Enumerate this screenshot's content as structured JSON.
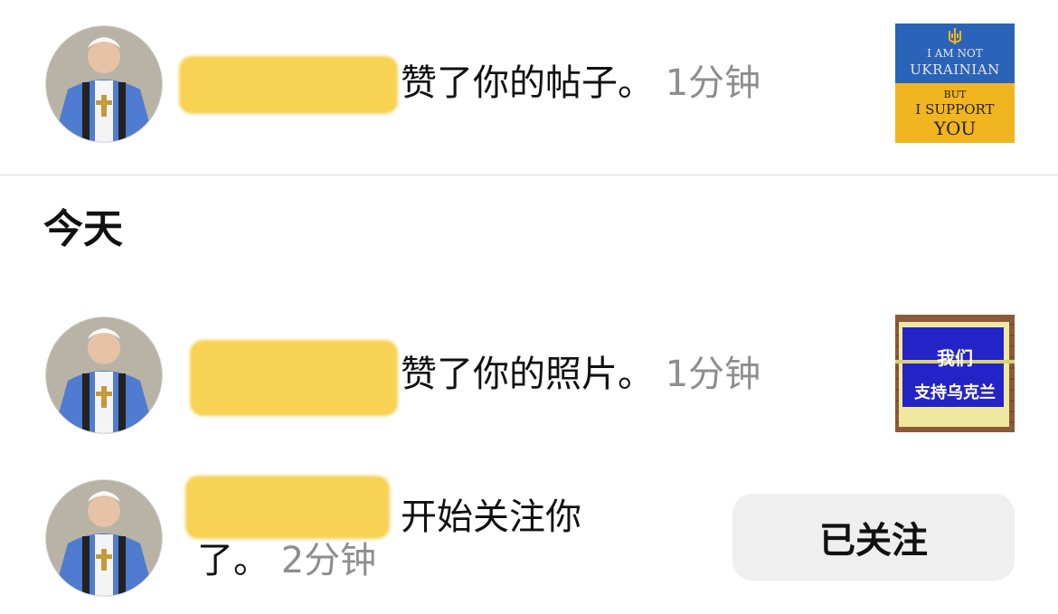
{
  "notifications": [
    {
      "action": "赞了你的帖子。",
      "time": "1分钟",
      "thumbnail": {
        "icon": "trident-icon",
        "line1": "I AM NOT",
        "line2": "UKRAINIAN",
        "line3": "BUT",
        "line4": "I SUPPORT",
        "line5": "YOU",
        "colors": {
          "top": "#2b63b8",
          "bottom": "#f1b51f"
        }
      }
    },
    {
      "action": "赞了你的照片。",
      "time": "1分钟",
      "thumbnail": {
        "line1": "我们",
        "line2": "支持乌克兰",
        "colors": {
          "sign": "#2323c8",
          "board": "#f1e8a0",
          "wall": "#8a5a3a"
        }
      }
    },
    {
      "action_line1": "开始关注你",
      "action_line2": "了。",
      "time": "2分钟",
      "button_label": "已关注"
    }
  ],
  "section": {
    "title": "今天"
  },
  "colors": {
    "redaction": "#f7d04a",
    "timestamp": "#8e8e8e",
    "button_bg": "#efefef"
  }
}
